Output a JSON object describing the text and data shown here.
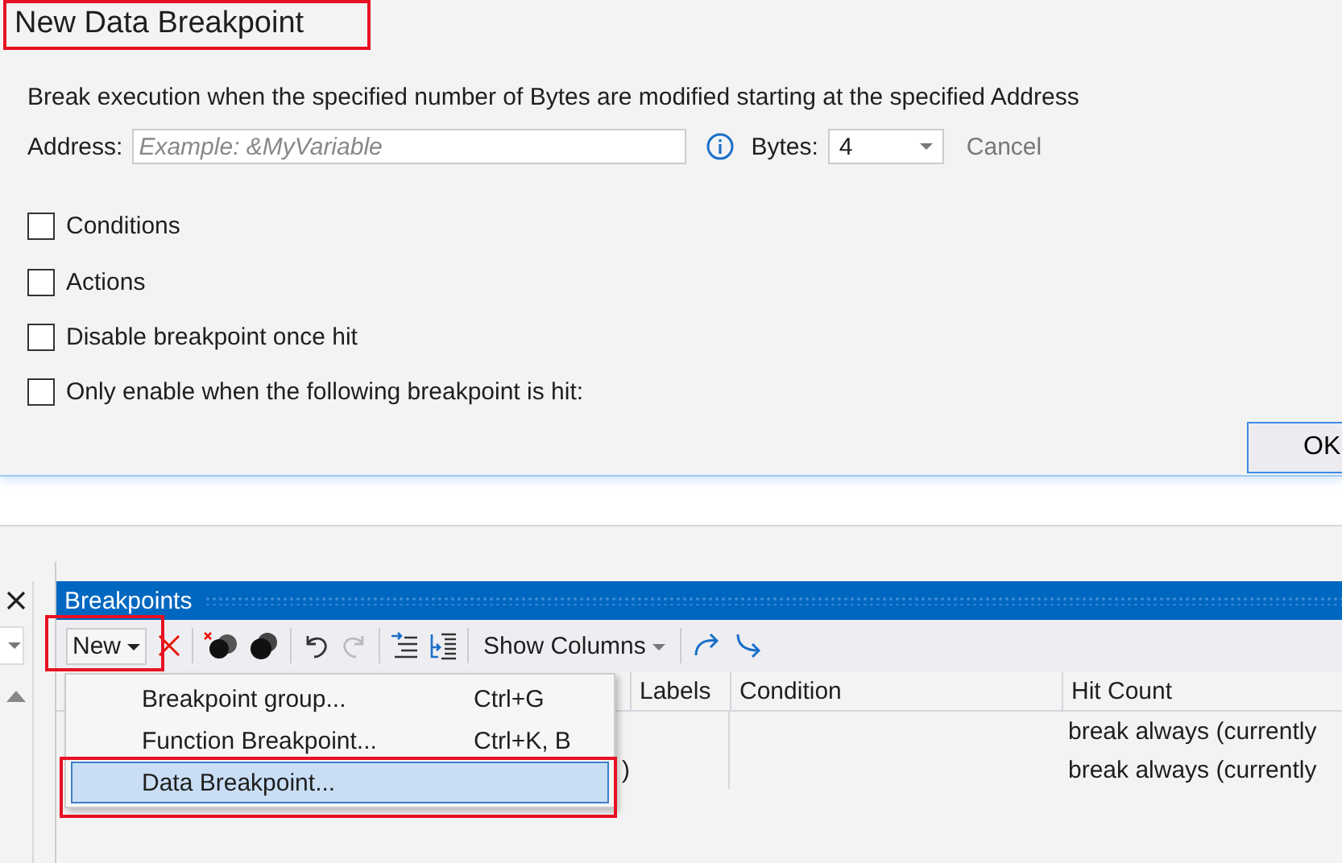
{
  "dialog": {
    "title": "New Data Breakpoint",
    "description": "Break execution when the specified number of Bytes are modified starting at the specified Address",
    "address": {
      "label": "Address:",
      "placeholder": "Example: &MyVariable"
    },
    "bytes": {
      "label": "Bytes:",
      "value": "4"
    },
    "cancel": "Cancel",
    "options": [
      {
        "label": "Conditions",
        "checked": false
      },
      {
        "label": "Actions",
        "checked": false
      },
      {
        "label": "Disable breakpoint once hit",
        "checked": false
      },
      {
        "label": "Only enable when the following breakpoint is hit:",
        "checked": false
      }
    ],
    "ok": "OK"
  },
  "breakpoints": {
    "title": "Breakpoints",
    "toolbar": {
      "new": "New",
      "show_columns": "Show Columns"
    },
    "columns": [
      "Labels",
      "Condition",
      "Hit Count"
    ],
    "rows": [
      {
        "hit_count": "break always (currently"
      },
      {
        "column_1": ")",
        "hit_count": "break always (currently"
      }
    ],
    "menu": [
      {
        "label": "Breakpoint group...",
        "shortcut": "Ctrl+G",
        "selected": false
      },
      {
        "label": "Function Breakpoint...",
        "shortcut": "Ctrl+K, B",
        "selected": false
      },
      {
        "label": "Data Breakpoint...",
        "selected": true
      }
    ]
  }
}
